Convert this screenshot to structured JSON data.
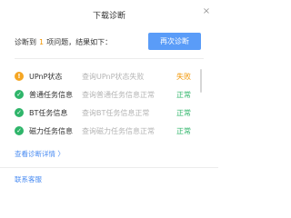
{
  "window": {
    "title": "下载诊断",
    "close_icon": "×"
  },
  "summary": {
    "prefix": "诊断到",
    "count": "1",
    "suffix": "项问题，结果如下：",
    "count_color": "#f29500"
  },
  "actions": {
    "rediagnose_label": "再次诊断",
    "accent_color": "#5a9cf8"
  },
  "results": [
    {
      "icon": "warning-icon",
      "icon_glyph": "!",
      "name": "UPnP状态",
      "description": "查询UPnP状态失败",
      "status": "失败"
    },
    {
      "icon": "check-icon",
      "icon_glyph": "✓",
      "name": "普通任务信息",
      "description": "查询普通任务信息正常",
      "status": "正常"
    },
    {
      "icon": "check-icon",
      "icon_glyph": "✓",
      "name": "BT任务信息",
      "description": "查询BT任务信息正常",
      "status": "正常"
    },
    {
      "icon": "check-icon",
      "icon_glyph": "✓",
      "name": "磁力任务信息",
      "description": "查询磁力任务信息正常",
      "status": "正常"
    }
  ],
  "links": {
    "view_details": "查看诊断详情 〉",
    "contact_support": "联系客服"
  },
  "colors": {
    "fail": "#f29500",
    "pass": "#2fb56a"
  }
}
